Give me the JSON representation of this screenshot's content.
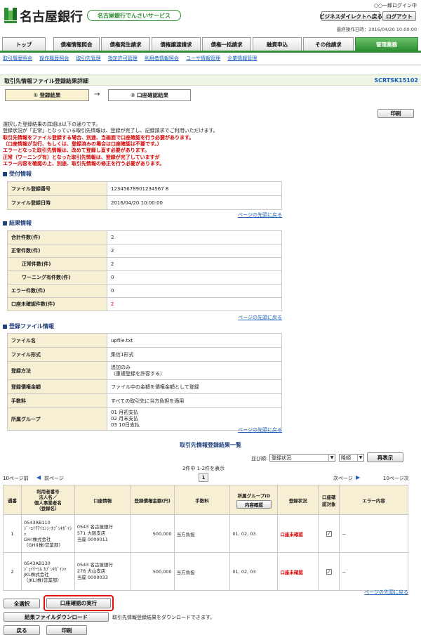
{
  "header": {
    "bank_name": "名古屋銀行",
    "service_name": "名古屋銀行でんさいサービス",
    "user_login": "○○一郎ログイン中",
    "last_operation": "最終操作日時：2016/04/20 10:00:00",
    "business_direct_button": "ビジネスダイレクトへ戻る",
    "logout_button": "ログアウト"
  },
  "nav": {
    "tabs": [
      "トップ",
      "債権情報照会",
      "債権発生請求",
      "債権譲渡請求",
      "債権一括請求",
      "融資申込",
      "その他請求",
      "管理業務"
    ],
    "active_index": 7
  },
  "subnav": [
    "取引履歴照会",
    "操作履歴照会",
    "取引先管理",
    "指定許可管理",
    "利用者情報照会",
    "ユーザ情報管理",
    "企業情報管理"
  ],
  "page": {
    "title": "取引先情報ファイル登録結果詳細",
    "screen_id": "SCRTSK15102",
    "step1": "① 登録結果",
    "step2": "② 口座確認結果",
    "print_button": "印刷",
    "intro_lines": [
      "選択した登録結果の詳細は以下の通りです。",
      "登録状況が「正常」となっている取引先情報は、登録が完了し、記録請求でご利用いただけます。"
    ],
    "warning_lines": [
      "取引先情報をファイル登録する場合、別途、当画面で口座確認を行う必要があります。",
      "（口座情報が当行、もしくは、登録済みの場合は口座確認は不要です。）",
      "エラーとなった取引先情報は、改めて登録し直す必要があります。",
      "正常（ワーニング有）となった取引先情報は、登録が完了していますが",
      "エラー内容を確認の上、別途、取引先情報の修正を行う必要があります。"
    ],
    "back_to_top": "ページの先頭に戻る"
  },
  "reception": {
    "heading": "受付情報",
    "rows": [
      {
        "label": "ファイル登録番号",
        "value": "12345678901234567 8"
      },
      {
        "label": "ファイル登録日時",
        "value": "2016/04/20 10:00:00"
      }
    ]
  },
  "result": {
    "heading": "結果情報",
    "rows": [
      {
        "label": "合計件数(件)",
        "value": "2"
      },
      {
        "label": "正常件数(件)",
        "value": "2"
      },
      {
        "label": "正常件数(件)",
        "value": "2"
      },
      {
        "label": "ワーニング有件数(件)",
        "value": "0"
      },
      {
        "label": "エラー件数(件)",
        "value": "0"
      },
      {
        "label": "口座未確認件数(件)",
        "value": "2"
      }
    ]
  },
  "file_info": {
    "heading": "登録ファイル情報",
    "rows": [
      {
        "label": "ファイル名",
        "value": "upfile.txt"
      },
      {
        "label": "ファイル形式",
        "value": "集信1形式"
      },
      {
        "label": "登録方法",
        "value1": "追加のみ",
        "value2": "（重複登録を許容する）"
      },
      {
        "label": "登録債権金額",
        "value": "ファイル中の金額を債権金額として登録"
      },
      {
        "label": "手数料",
        "value": "すべての取引先に当方負担を適用"
      },
      {
        "label": "所属グループ",
        "value1": "01 月初支払",
        "value2": "02 月末支払",
        "value3": "03 10日支払"
      }
    ]
  },
  "list": {
    "title": "取引先情報登録結果一覧",
    "sort_label": "並び順:",
    "sort_value": "登録状況",
    "order_value": "降順",
    "redisplay_button": "再表示",
    "count_text": "2件中 1-2件を表示",
    "prev10": "10ページ前",
    "prev": "前ページ",
    "page_current": "1",
    "next": "次ページ",
    "next10": "10ページ次",
    "headers": {
      "seq": "通番",
      "user_no": "利用者番号",
      "corp_name": "法人名／",
      "personal": "個人事業者名",
      "reg_name": "（登録名）",
      "account": "口座情報",
      "amount": "登録債権金額(円)",
      "fee": "手数料",
      "group": "所属グループID",
      "content_check": "内容確認",
      "status": "登録状況",
      "acct_confirm": "口座確認対象",
      "error": "エラー内容"
    },
    "rows": [
      {
        "seq": "1",
        "user_no": "0543AB110",
        "name_kana": "ｼﾞｰｴｲﾁｱｲｴﾝｼｰｶﾌﾞｼｷｶﾞｲｼｬ",
        "name": "GH!株式会社",
        "reg_name": "（GHI(株)営業部）",
        "bank": "0543 名古屋銀行",
        "branch": "571 大阪支店",
        "acct": "当座 0000011",
        "amount": "500,000",
        "fee": "当方負担",
        "group": "01, 02, 03",
        "status": "口座未確認",
        "error": "－"
      },
      {
        "seq": "2",
        "user_no": "0543AB130",
        "name_kana": "ｼﾞｪｲｹｰｴﾙ ｶﾌﾞｼｷｶﾞｲｼｬ",
        "name": "JKL株式会社",
        "reg_name": "（JKL(株)営業部）",
        "bank": "0543 名古屋銀行",
        "branch": "278 犬山支店",
        "acct": "当座 0000033",
        "amount": "500,000",
        "fee": "当方負担",
        "group": "01, 02, 03",
        "status": "口座未確認",
        "error": "－"
      }
    ]
  },
  "footer": {
    "select_all": "全選択",
    "execute_confirm": "口座確認の実行",
    "download_button": "結果ファイルダウンロード",
    "download_note": "取引先情報登録結果をダウンロードできます。",
    "back_button": "戻る",
    "print_button": "印刷"
  },
  "colors": {
    "brand_green": "#2f8f33",
    "heading_navy": "#1f3f7a",
    "label_bg": "#f7efd3",
    "alert_red": "#d40000",
    "link_blue": "#1b5fb8"
  }
}
